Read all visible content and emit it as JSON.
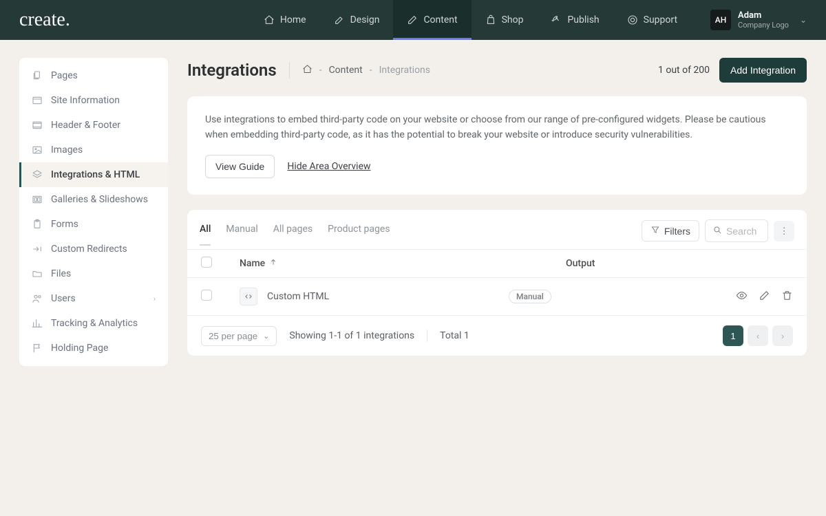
{
  "brand": "create",
  "nav": [
    {
      "label": "Home"
    },
    {
      "label": "Design"
    },
    {
      "label": "Content"
    },
    {
      "label": "Shop"
    },
    {
      "label": "Publish"
    },
    {
      "label": "Support"
    }
  ],
  "user": {
    "initials": "AH",
    "name": "Adam",
    "company": "Company Logo"
  },
  "sidebar": [
    {
      "label": "Pages"
    },
    {
      "label": "Site Information"
    },
    {
      "label": "Header & Footer"
    },
    {
      "label": "Images"
    },
    {
      "label": "Integrations & HTML"
    },
    {
      "label": "Galleries & Slideshows"
    },
    {
      "label": "Forms"
    },
    {
      "label": "Custom Redirects"
    },
    {
      "label": "Files"
    },
    {
      "label": "Users"
    },
    {
      "label": "Tracking & Analytics"
    },
    {
      "label": "Holding Page"
    }
  ],
  "page": {
    "title": "Integrations",
    "breadcrumb": {
      "section": "Content",
      "current": "Integrations"
    },
    "status": "1 out of 200",
    "add_label": "Add Integration"
  },
  "overview": {
    "text": "Use integrations to embed third-party code on your website or choose from our range of pre-configured widgets. Please be cautious when embedding third-party code, as it has the potential to break your website or introduce security vulnerabilities.",
    "view_guide": "View Guide",
    "hide_overview": "Hide Area Overview"
  },
  "table": {
    "tabs": [
      "All",
      "Manual",
      "All pages",
      "Product pages"
    ],
    "filters_label": "Filters",
    "search_placeholder": "Search",
    "columns": {
      "name": "Name",
      "output": "Output"
    },
    "rows": [
      {
        "name": "Custom HTML",
        "output_badge": "Manual"
      }
    ],
    "per_page": "25 per page",
    "showing": "Showing 1-1 of 1 integrations",
    "total": "Total 1",
    "page_current": "1"
  }
}
